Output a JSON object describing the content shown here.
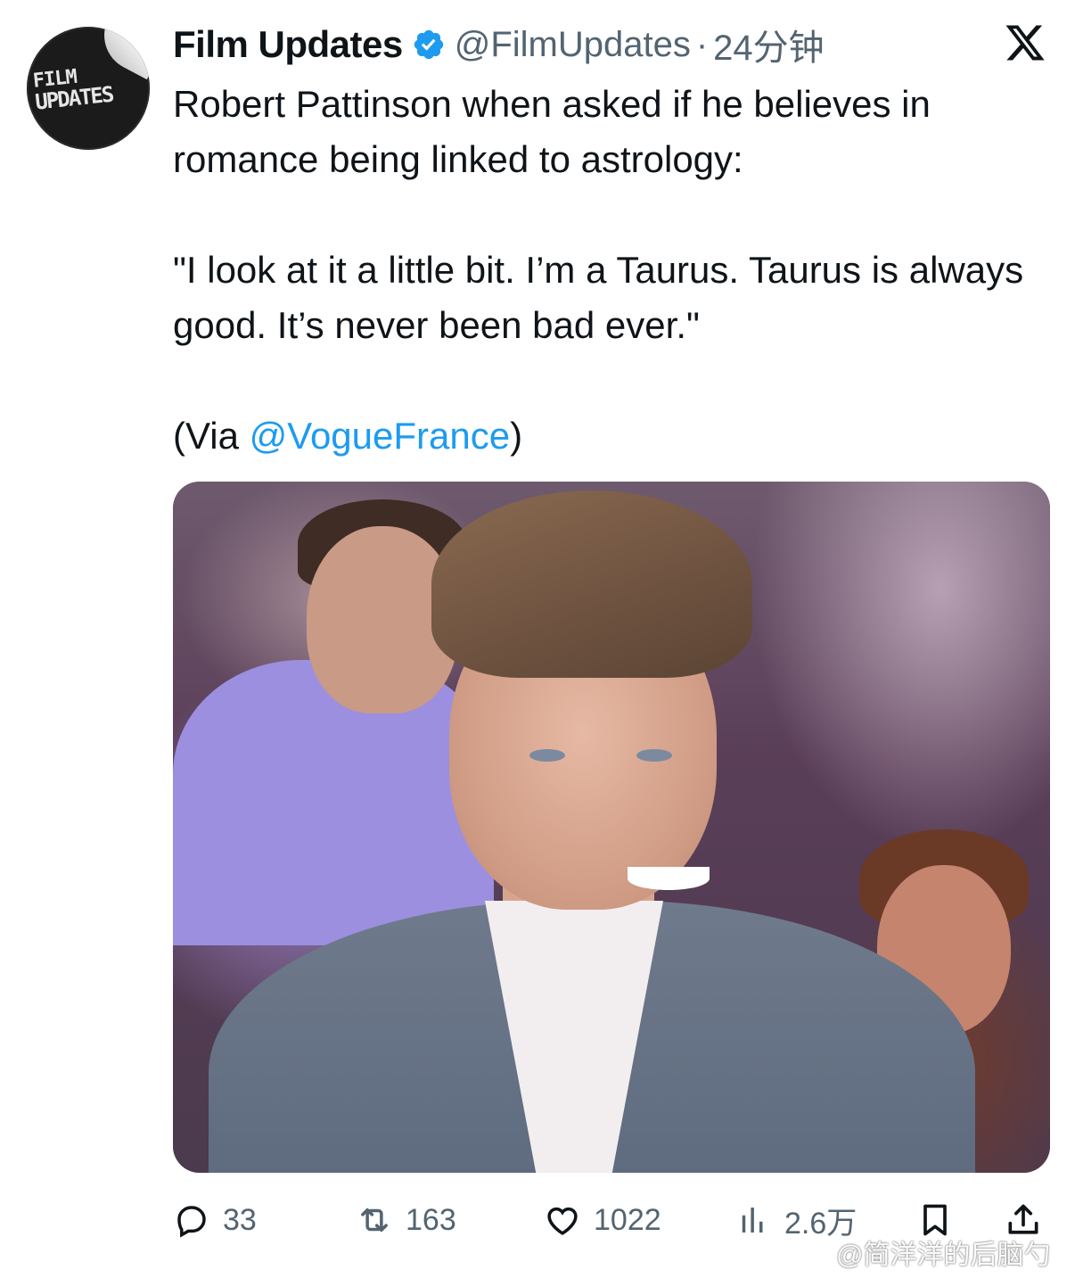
{
  "tweet": {
    "author_name": "Film Updates",
    "handle": "@FilmUpdates",
    "separator": "·",
    "time": "24分钟",
    "avatar_text_line1": "FILM",
    "avatar_text_line2": "UPDATES",
    "text_line1": "Robert Pattinson when asked if he believes in romance being linked to astrology:",
    "quote": "\"I look at it a little bit. I’m a Taurus. Taurus is always good. It’s never been bad ever.\"",
    "via_prefix": "(Via ",
    "via_mention": "@VogueFrance",
    "via_suffix": ")"
  },
  "actions": {
    "replies": "33",
    "reposts": "163",
    "likes": "1022",
    "views": "2.6万"
  },
  "watermark": {
    "text": "@简洋洋的后脑勺"
  },
  "icons": [
    "verified-badge-icon",
    "x-logo-icon",
    "reply-icon",
    "repost-icon",
    "like-icon",
    "views-icon",
    "bookmark-icon",
    "share-icon",
    "weibo-icon"
  ],
  "colors": {
    "text": "#0f1419",
    "secondary": "#536471",
    "link": "#1d9bf0",
    "verified": "#1d9bf0"
  }
}
